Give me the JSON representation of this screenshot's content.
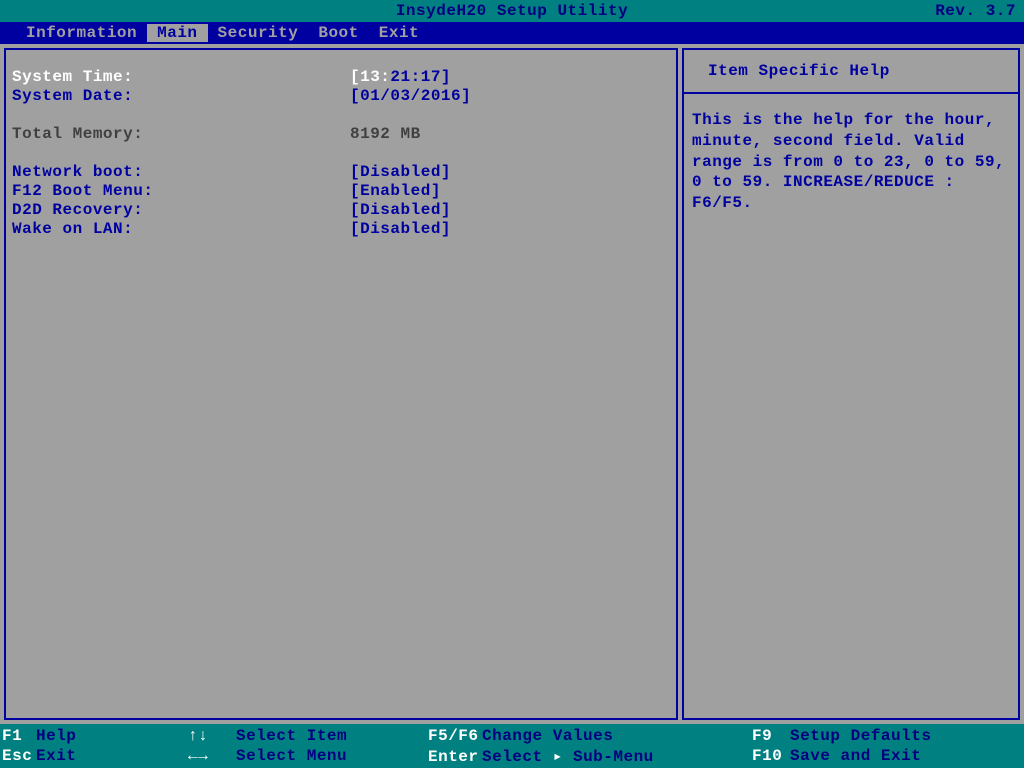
{
  "title": "InsydeH20 Setup Utility",
  "revision": "Rev. 3.7",
  "menu": {
    "information": "Information",
    "main": "Main",
    "security": "Security",
    "boot": "Boot",
    "exit": "Exit"
  },
  "fields": {
    "system_time": {
      "label": "System Time:",
      "prefix": "[13:",
      "rest": "21:17]"
    },
    "system_date": {
      "label": "System Date:",
      "value": "[01/03/2016]"
    },
    "total_memory": {
      "label": "Total Memory:",
      "value": "8192 MB"
    },
    "network_boot": {
      "label": "Network boot:",
      "value": "[Disabled]"
    },
    "f12_boot_menu": {
      "label": "F12 Boot Menu:",
      "value": "[Enabled]"
    },
    "d2d_recovery": {
      "label": "D2D Recovery:",
      "value": "[Disabled]"
    },
    "wake_on_lan": {
      "label": "Wake on LAN:",
      "value": "[Disabled]"
    }
  },
  "help": {
    "title": "Item Specific Help",
    "body": "This is the help for the hour, minute, second field. Valid range is from 0 to 23, 0 to 59, 0 to 59.  INCREASE/REDUCE : F6/F5."
  },
  "footer": {
    "arrows_ud": "↑↓",
    "arrows_lr": "←→",
    "submenu_arrow": "▸",
    "f1": "F1",
    "help": "Help",
    "esc": "Esc",
    "exit": "Exit",
    "select_item": "Select Item",
    "select_menu": "Select Menu",
    "f5f6": "F5/F6",
    "change_values": "Change Values",
    "enter": "Enter",
    "select_submenu_a": "Select ",
    "select_submenu_b": " Sub-Menu",
    "f9": "F9",
    "setup_defaults": "Setup Defaults",
    "f10": "F10",
    "save_exit": "Save and Exit"
  }
}
